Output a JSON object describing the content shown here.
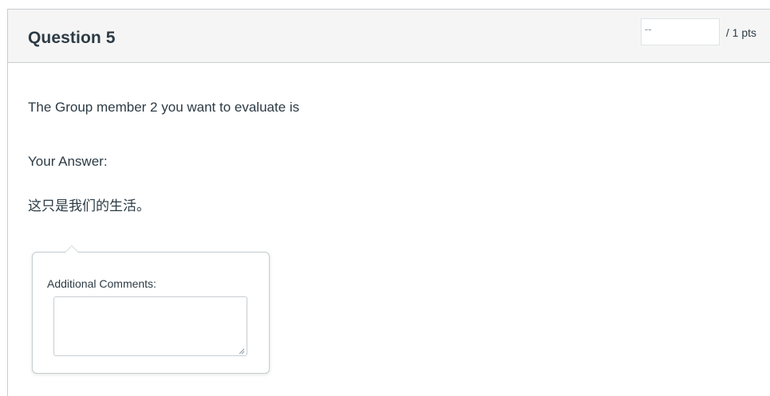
{
  "question": {
    "title": "Question 5",
    "points": {
      "value": "",
      "placeholder": "--",
      "suffix": "/ 1 pts"
    },
    "text": "The Group member 2 you want to evaluate is",
    "answer_label": "Your Answer:",
    "answer_text": "这只是我们的生活。"
  },
  "comments": {
    "label": "Additional Comments:",
    "value": ""
  },
  "colors": {
    "header_bg": "#f5f5f5",
    "border": "#c7cdd1",
    "text": "#2d3b45"
  }
}
